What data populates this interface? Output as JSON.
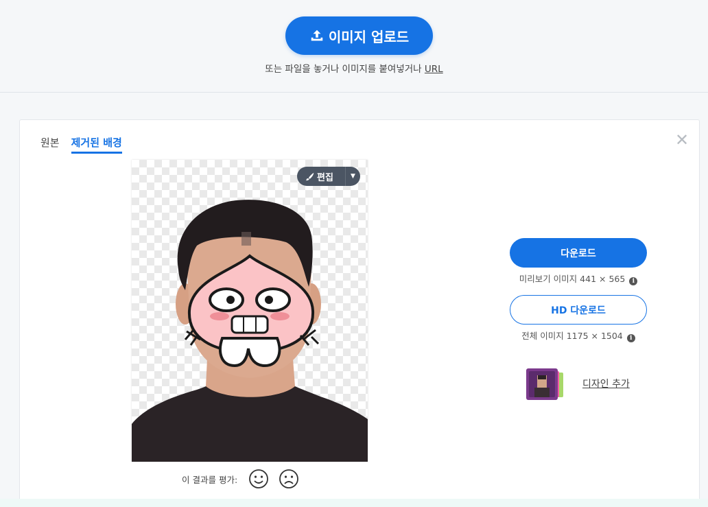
{
  "upload": {
    "button_label": "이미지 업로드",
    "hint_text": "또는 파일을 놓거나 이미지를 붙여넣거나",
    "url_link": "URL"
  },
  "tabs": [
    {
      "label": "원본",
      "active": false
    },
    {
      "label": "제거된 배경",
      "active": true
    }
  ],
  "editor": {
    "edit_label": "편집"
  },
  "rating": {
    "label": "이 결과를 평가:"
  },
  "download": {
    "label": "다운로드",
    "info_prefix": "미리보기 이미지",
    "info_size": "441 × 565"
  },
  "hd_download": {
    "label": "HD 다운로드",
    "info_prefix": "전체 이미지",
    "info_size": "1175 × 1504"
  },
  "design": {
    "label": "디자인 추가"
  },
  "colors": {
    "primary": "#1673e4",
    "edit_bg": "#4b5563"
  },
  "icons": {
    "upload": "upload-icon",
    "close": "close-icon",
    "brush": "brush-icon",
    "caret": "caret-down-icon",
    "info": "info-icon",
    "happy": "smiley-icon",
    "sad": "frown-icon"
  }
}
